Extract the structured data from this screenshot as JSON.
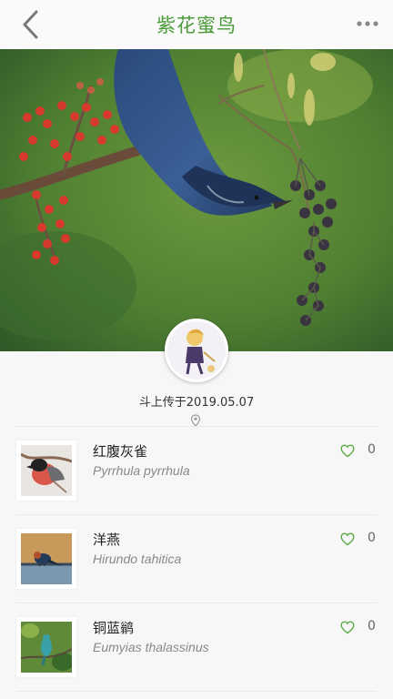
{
  "header": {
    "title": "紫花蜜鸟",
    "back_icon": "chevron-left-icon",
    "more_icon": "more-dots-icon",
    "accent_color": "#4c9a3a"
  },
  "upload": {
    "text": "斗上传于2019.05.07",
    "location_icon": "location-pin-icon"
  },
  "birds": [
    {
      "cn": "红腹灰雀",
      "latin": "Pyrrhula pyrrhula",
      "likes": "0"
    },
    {
      "cn": "洋燕",
      "latin": "Hirundo tahitica",
      "likes": "0"
    },
    {
      "cn": "铜蓝鹟",
      "latin": "Eumyias thalassinus",
      "likes": "0"
    }
  ]
}
